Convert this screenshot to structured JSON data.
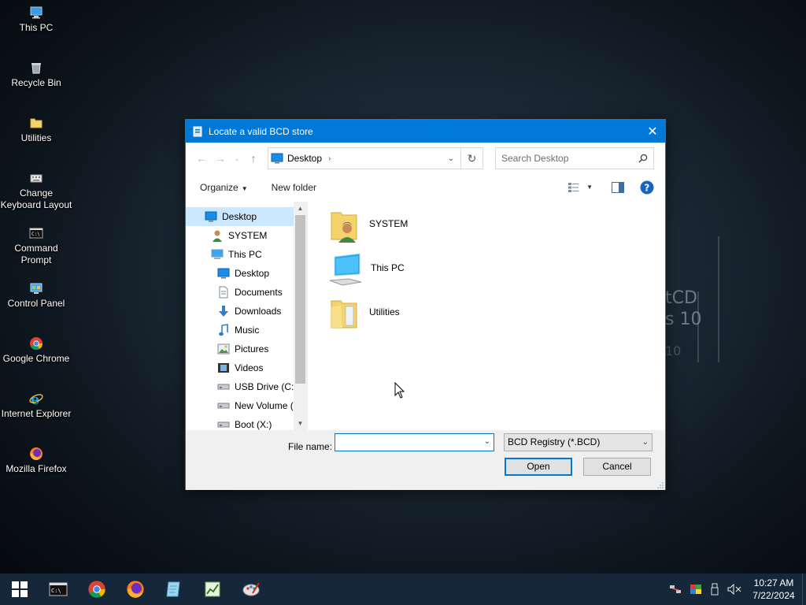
{
  "desktop": {
    "icons": [
      {
        "label": "This PC",
        "icon": "this-pc-icon"
      },
      {
        "label": "Recycle Bin",
        "icon": "recycle-bin-icon"
      },
      {
        "label": "Utilities",
        "icon": "folder-icon"
      },
      {
        "label": "Change Keyboard Layout",
        "icon": "keyboard-icon"
      },
      {
        "label": "Command Prompt",
        "icon": "cmd-icon"
      },
      {
        "label": "Control Panel",
        "icon": "control-panel-icon"
      },
      {
        "label": "Google Chrome",
        "icon": "chrome-icon"
      },
      {
        "label": "Internet Explorer",
        "icon": "ie-icon"
      },
      {
        "label": "Mozilla Firefox",
        "icon": "firefox-icon"
      }
    ],
    "watermark": [
      "tCD",
      "s 10",
      "10"
    ]
  },
  "dialog": {
    "title": "Locate a valid BCD store",
    "address": {
      "crumb": "Desktop"
    },
    "search_placeholder": "Search Desktop",
    "toolbar": {
      "organize": "Organize",
      "new_folder": "New folder"
    },
    "nav_items": [
      {
        "label": "Desktop",
        "icon": "desktop-icon",
        "indent": 1,
        "selected": true
      },
      {
        "label": "SYSTEM",
        "icon": "user-icon",
        "indent": 2
      },
      {
        "label": "This PC",
        "icon": "this-pc-icon",
        "indent": 2
      },
      {
        "label": "Desktop",
        "icon": "desktop-icon",
        "indent": 3
      },
      {
        "label": "Documents",
        "icon": "documents-icon",
        "indent": 3
      },
      {
        "label": "Downloads",
        "icon": "downloads-icon",
        "indent": 3
      },
      {
        "label": "Music",
        "icon": "music-icon",
        "indent": 3
      },
      {
        "label": "Pictures",
        "icon": "pictures-icon",
        "indent": 3
      },
      {
        "label": "Videos",
        "icon": "videos-icon",
        "indent": 3
      },
      {
        "label": "USB Drive (C:)",
        "icon": "drive-icon",
        "indent": 3
      },
      {
        "label": "New Volume (D",
        "icon": "drive-icon",
        "indent": 3
      },
      {
        "label": "Boot (X:)",
        "icon": "drive-icon",
        "indent": 3
      }
    ],
    "files": [
      {
        "name": "SYSTEM",
        "icon": "user-folder-icon"
      },
      {
        "name": "This PC",
        "icon": "this-pc-icon"
      },
      {
        "name": "Utilities",
        "icon": "folder-icon"
      }
    ],
    "footer": {
      "file_name_label": "File name:",
      "file_name_value": "",
      "filter": "BCD Registry (*.BCD)",
      "open": "Open",
      "cancel": "Cancel"
    }
  },
  "taskbar": {
    "apps": [
      "start-icon",
      "cmd-icon",
      "chrome-icon",
      "firefox-icon",
      "notepad-icon",
      "chart-app-icon",
      "paint-icon"
    ],
    "time": "10:27 AM",
    "date": "7/22/2024"
  },
  "colors": {
    "accent": "#0078d7",
    "taskbar": "#16273a",
    "selection": "#cce8ff"
  }
}
